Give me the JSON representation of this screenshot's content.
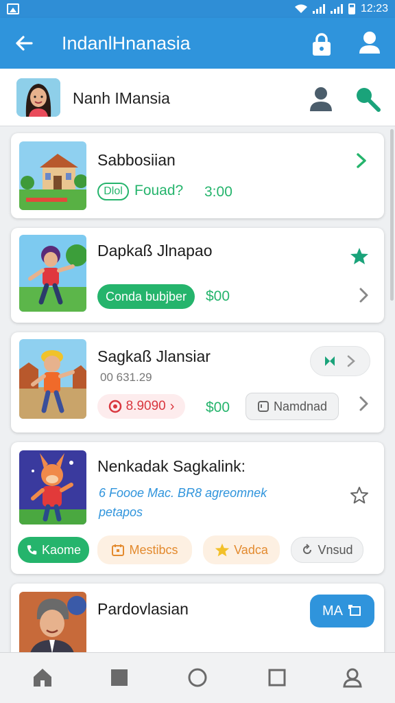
{
  "status_bar": {
    "time": "12:23"
  },
  "app_bar": {
    "title": "IndanlHnanasia",
    "back_icon": "arrow-left-icon",
    "lock_icon": "lock-icon",
    "user_icon": "user-icon"
  },
  "profile": {
    "name": "Nanh IMansia",
    "person_icon": "person-icon",
    "search_icon": "search-icon"
  },
  "colors": {
    "primary": "#2f94dc",
    "green": "#25b46c",
    "orange": "#e38a2e",
    "red": "#d9363e",
    "blue_button": "#2f94dc"
  },
  "items": [
    {
      "title": "Sabbosiian",
      "badge": "Dlol",
      "subtitle": "Fouad?",
      "price": "3:00"
    },
    {
      "title": "Dapkaß Jlnapao",
      "button": "Conda bubjber",
      "price": "$00"
    },
    {
      "title": "Sagkaß Jlansiar",
      "meta": "00 631.29",
      "chip": "8.9090",
      "price": "$00",
      "secondary_button": "Namdnad"
    },
    {
      "title": "Nenkadak Sagkalink:",
      "description_line1": "6 Foooe Mac. BR8 agreomnek",
      "description_line2": "petapos",
      "tags": [
        "Kaome",
        "Mestibcs",
        "Vadca",
        "Vnsud"
      ]
    },
    {
      "title": "Pardovlasian",
      "button": "MA"
    }
  ]
}
